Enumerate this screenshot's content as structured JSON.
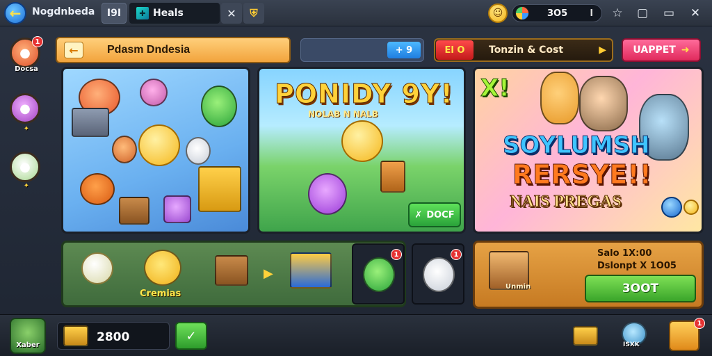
{
  "topbar": {
    "title": "Nogdnbeda",
    "tabs": [
      {
        "label": "I9I"
      },
      {
        "label": "Heals"
      }
    ],
    "currency_value": "3O5",
    "currency_suffix": "l"
  },
  "sidebar": {
    "items": [
      {
        "label": "Docsa",
        "badge": "1",
        "color": "#ff7a4a"
      },
      {
        "label": "",
        "badge": "",
        "color": "#d070e0"
      },
      {
        "label": "",
        "badge": "",
        "color": "#e8f2d0"
      }
    ]
  },
  "header": {
    "title": "Pdasm Dndesia",
    "search_chip": "+ 9",
    "event_tag": "El O",
    "event_text": "Tonzin & Cost",
    "cta_label": "UAPPET"
  },
  "cards": [
    {
      "theme": "pets",
      "headline": "",
      "colors": [
        "#ff6b3d",
        "#e48ad8",
        "#6ad04a",
        "#ffcc33"
      ]
    },
    {
      "theme": "jungle",
      "headline": "PONIDY 9Y!",
      "subline": "NOLAB N   NALB",
      "button": "DOCF"
    },
    {
      "theme": "heroes",
      "badge": "X!",
      "headline_1": "SOYLUMSH",
      "headline_2": "RERSYE!!",
      "subline": "NAIS PREGAS"
    }
  ],
  "strip": {
    "label": "Cremias",
    "badges": [
      "1",
      "1"
    ]
  },
  "reward": {
    "line_1": "Salo 1X:00",
    "line_2": "Dslonpt X 1O05",
    "button": "3OOT",
    "chest_label": "Unmin"
  },
  "bottombar": {
    "player_name": "Xaber",
    "gold": "2800",
    "chest_label": "ISXK",
    "notif_badge": "1"
  },
  "colors": {
    "accent_orange": "#f2a43d",
    "accent_green": "#3aa52a",
    "accent_pink": "#e02a5c",
    "accent_blue": "#1f7ee0"
  }
}
